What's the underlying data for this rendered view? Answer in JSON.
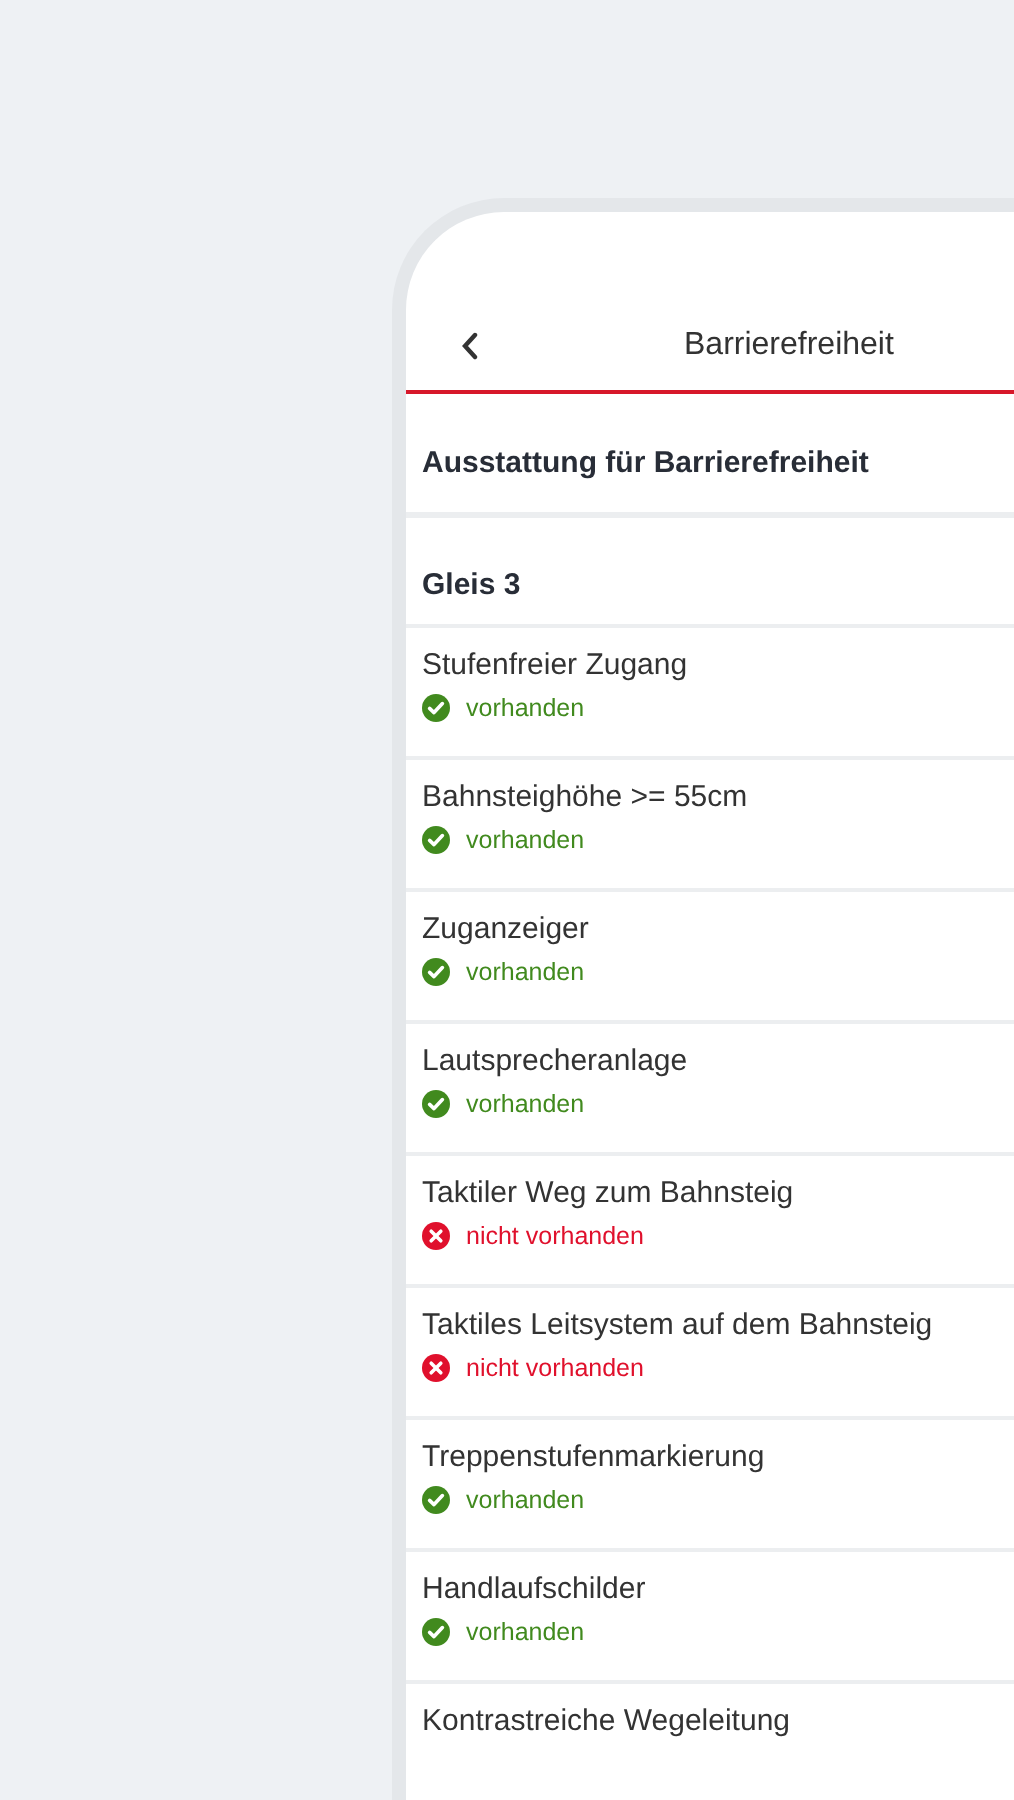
{
  "header": {
    "title": "Barrierefreiheit"
  },
  "section_title": "Ausstattung für Barrierefreiheit",
  "group_title": "Gleis 3",
  "items": [
    {
      "name": "Stufenfreier Zugang",
      "available": true,
      "status": "vorhanden"
    },
    {
      "name": "Bahnsteighöhe >= 55cm",
      "available": true,
      "status": "vorhanden"
    },
    {
      "name": "Zuganzeiger",
      "available": true,
      "status": "vorhanden"
    },
    {
      "name": "Lautsprecheranlage",
      "available": true,
      "status": "vorhanden"
    },
    {
      "name": "Taktiler Weg zum Bahnsteig",
      "available": false,
      "status": "nicht vorhanden"
    },
    {
      "name": "Taktiles Leitsystem auf dem Bahnsteig",
      "available": false,
      "status": "nicht vorhanden"
    },
    {
      "name": "Treppenstufenmarkierung",
      "available": true,
      "status": "vorhanden"
    },
    {
      "name": "Handlaufschilder",
      "available": true,
      "status": "vorhanden"
    },
    {
      "name": "Kontrastreiche Wegeleitung"
    }
  ]
}
